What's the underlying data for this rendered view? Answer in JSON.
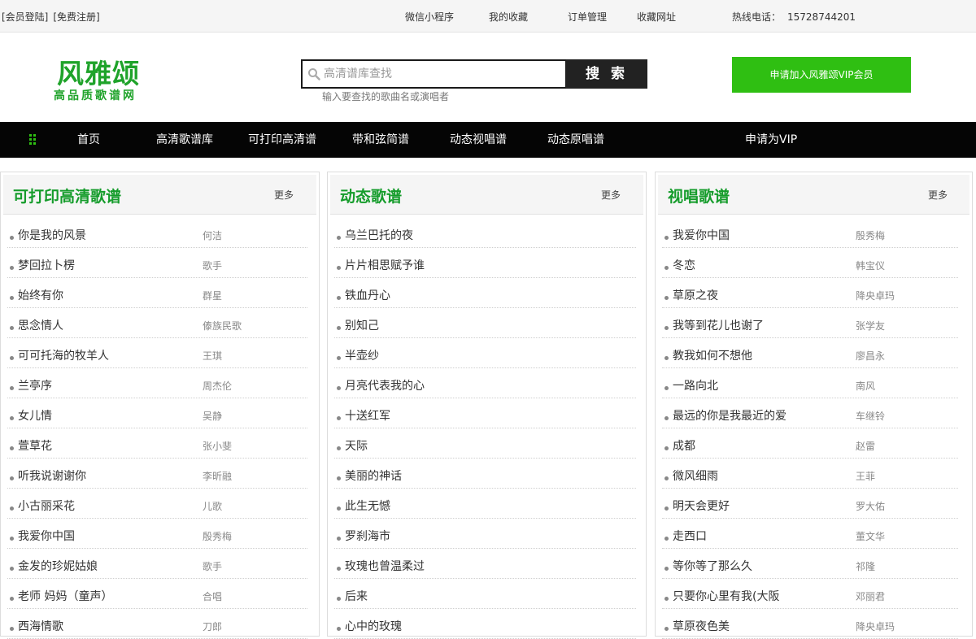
{
  "topbar": {
    "login": "[会员登陆]",
    "register": "[免费注册]",
    "links": [
      "微信小程序",
      "我的收藏",
      "订单管理",
      "收藏网址"
    ],
    "hotline_label": "热线电话：",
    "hotline_number": "15728744201"
  },
  "logo": {
    "title": "风雅颂",
    "subtitle": "高品质歌谱网"
  },
  "search": {
    "placeholder": "高清谱库查找",
    "button": "搜 索",
    "hint": "输入要查找的歌曲名或演唱者"
  },
  "vip_button": "申请加入风雅颂VIP会员",
  "nav": {
    "items": [
      "首页",
      "高清歌谱库",
      "可打印高清谱",
      "带和弦简谱",
      "动态视唱谱",
      "动态原唱谱",
      "申请为VIP"
    ]
  },
  "panels": [
    {
      "title": "可打印高清歌谱",
      "more": "更多",
      "items": [
        {
          "song": "你是我的风景",
          "artist": "何洁"
        },
        {
          "song": "梦回拉卜楞",
          "artist": "歌手"
        },
        {
          "song": "始终有你",
          "artist": "群星"
        },
        {
          "song": "思念情人",
          "artist": "傣族民歌"
        },
        {
          "song": "可可托海的牧羊人",
          "artist": "王琪"
        },
        {
          "song": "兰亭序",
          "artist": "周杰伦"
        },
        {
          "song": "女儿情",
          "artist": "吴静"
        },
        {
          "song": "萱草花",
          "artist": "张小斐"
        },
        {
          "song": "听我说谢谢你",
          "artist": "李昕融"
        },
        {
          "song": "小古丽采花",
          "artist": "儿歌"
        },
        {
          "song": "我爱你中国",
          "artist": "殷秀梅"
        },
        {
          "song": "金发的珍妮姑娘",
          "artist": "歌手"
        },
        {
          "song": "老师 妈妈（童声）",
          "artist": "合唱"
        },
        {
          "song": "西海情歌",
          "artist": "刀郎"
        }
      ]
    },
    {
      "title": "动态歌谱",
      "more": "更多",
      "items": [
        {
          "song": "乌兰巴托的夜",
          "artist": ""
        },
        {
          "song": "片片相思赋予谁",
          "artist": ""
        },
        {
          "song": "铁血丹心",
          "artist": ""
        },
        {
          "song": "别知己",
          "artist": ""
        },
        {
          "song": "半壶纱",
          "artist": ""
        },
        {
          "song": "月亮代表我的心",
          "artist": ""
        },
        {
          "song": "十送红军",
          "artist": ""
        },
        {
          "song": "天际",
          "artist": ""
        },
        {
          "song": "美丽的神话",
          "artist": ""
        },
        {
          "song": "此生无憾",
          "artist": ""
        },
        {
          "song": "罗刹海市",
          "artist": ""
        },
        {
          "song": "玫瑰也曾温柔过",
          "artist": ""
        },
        {
          "song": "后来",
          "artist": ""
        },
        {
          "song": "心中的玫瑰",
          "artist": ""
        }
      ]
    },
    {
      "title": "视唱歌谱",
      "more": "更多",
      "items": [
        {
          "song": "我爱你中国",
          "artist": "殷秀梅"
        },
        {
          "song": "冬恋",
          "artist": "韩宝仪"
        },
        {
          "song": "草原之夜",
          "artist": "降央卓玛"
        },
        {
          "song": "我等到花儿也谢了",
          "artist": "张学友"
        },
        {
          "song": "教我如何不想他",
          "artist": "廖昌永"
        },
        {
          "song": "一路向北",
          "artist": "南风"
        },
        {
          "song": "最远的你是我最近的爱",
          "artist": "车继铃"
        },
        {
          "song": "成都",
          "artist": "赵雷"
        },
        {
          "song": "微风细雨",
          "artist": "王菲"
        },
        {
          "song": "明天会更好",
          "artist": "罗大佑"
        },
        {
          "song": "走西口",
          "artist": "董文华"
        },
        {
          "song": "等你等了那么久",
          "artist": "祁隆"
        },
        {
          "song": "只要你心里有我(大阪",
          "artist": "邓丽君"
        },
        {
          "song": "草原夜色美",
          "artist": "降央卓玛"
        }
      ]
    }
  ]
}
